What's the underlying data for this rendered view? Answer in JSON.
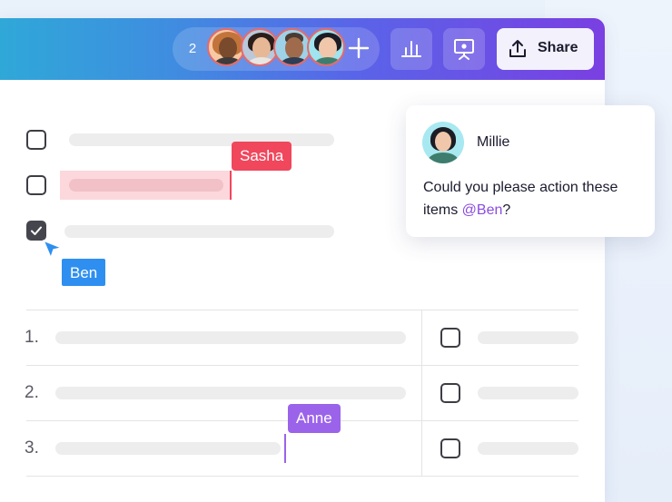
{
  "toolbar": {
    "collaborator_count": "2",
    "avatars": [
      "avatar-1",
      "avatar-2",
      "avatar-3",
      "avatar-4"
    ],
    "icons": [
      "plus-icon",
      "bar-chart-icon",
      "presenter-icon",
      "share-upload-icon"
    ],
    "share_label": "Share"
  },
  "cursors": {
    "sasha": "Sasha",
    "ben": "Ben",
    "anne": "Anne"
  },
  "cursor_colors": {
    "sasha": "#f0475d",
    "ben": "#2e8ff0",
    "anne": "#9b63ea"
  },
  "checklist": [
    {
      "checked": false
    },
    {
      "checked": false
    },
    {
      "checked": true
    }
  ],
  "numbered_list": [
    "1.",
    "2.",
    "3."
  ],
  "comment": {
    "author": "Millie",
    "text_before": "Could you please action these items ",
    "mention": "@Ben",
    "text_after": "?"
  }
}
